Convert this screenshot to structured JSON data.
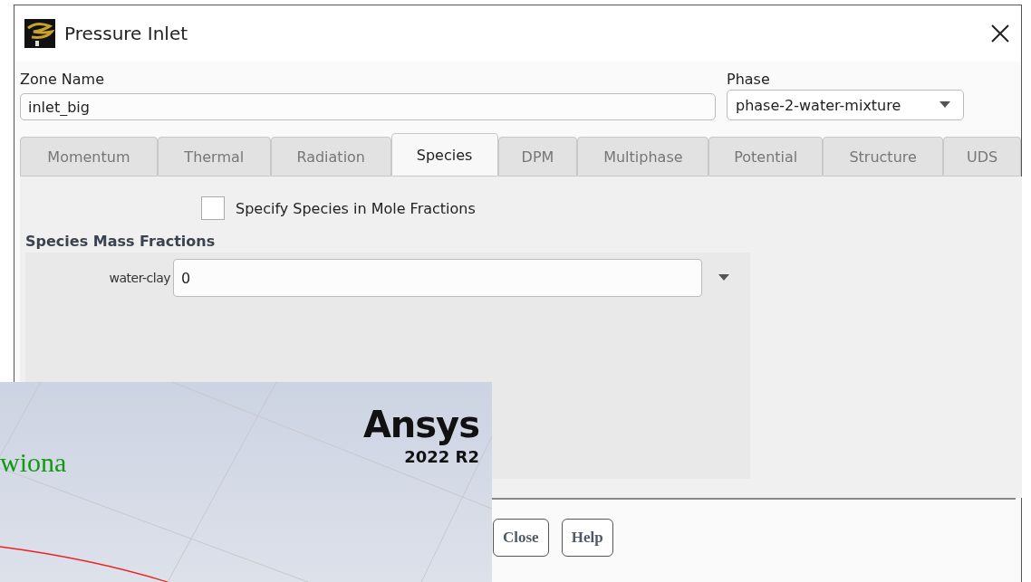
{
  "window": {
    "title": "Pressure Inlet"
  },
  "zone_name": {
    "label": "Zone Name",
    "value": "inlet_big"
  },
  "phase": {
    "label": "Phase",
    "value": "phase-2-water-mixture"
  },
  "tabs": [
    {
      "label": "Momentum",
      "selected": false
    },
    {
      "label": "Thermal",
      "selected": false
    },
    {
      "label": "Radiation",
      "selected": false
    },
    {
      "label": "Species",
      "selected": true
    },
    {
      "label": "DPM",
      "selected": false
    },
    {
      "label": "Multiphase",
      "selected": false
    },
    {
      "label": "Potential",
      "selected": false
    },
    {
      "label": "Structure",
      "selected": false
    },
    {
      "label": "UDS",
      "selected": false
    }
  ],
  "mole_fractions": {
    "label": "Specify Species in Mole Fractions",
    "checked": false
  },
  "section_title": "Species Mass Fractions",
  "species": [
    {
      "label": "water-clay",
      "value": "0"
    }
  ],
  "buttons": [
    "Close",
    "Help"
  ],
  "splash": {
    "text": "wiona",
    "logo": "Ansys",
    "version": "2022 R2"
  }
}
